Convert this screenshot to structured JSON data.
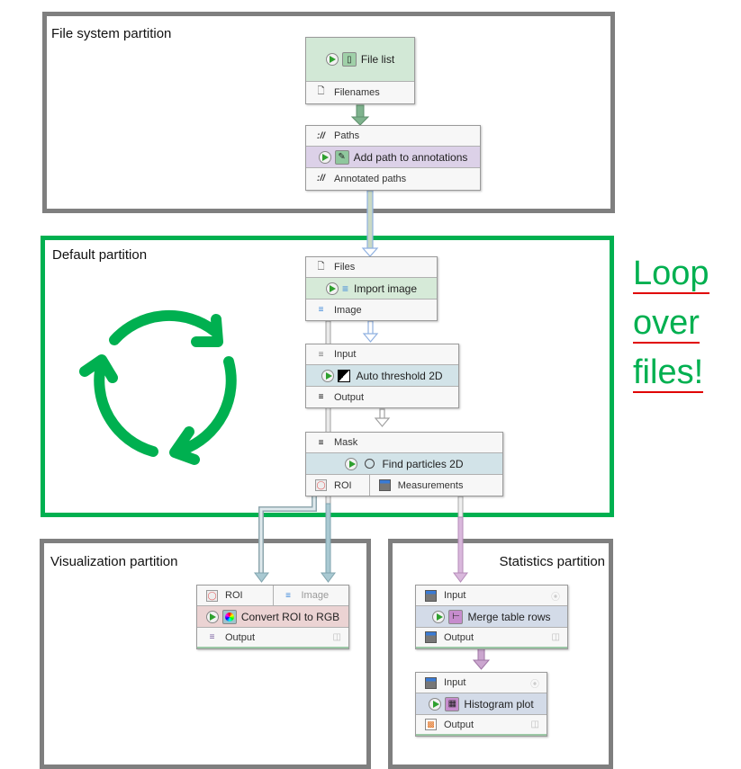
{
  "partitions": {
    "file_system": {
      "title": "File system partition"
    },
    "default": {
      "title": "Default partition"
    },
    "visualization": {
      "title": "Visualization partition"
    },
    "statistics": {
      "title": "Statistics partition"
    }
  },
  "annotation": {
    "lines": [
      "Loop",
      "over",
      "files!"
    ],
    "color": "#00b050",
    "underline_color": "#e00000"
  },
  "nodes": {
    "file_list": {
      "name": "File list",
      "color": "#d2e8d6",
      "outputs": [
        "Filenames"
      ]
    },
    "add_path": {
      "name": "Add path to annotations",
      "color": "#dcd1e8",
      "inputs": [
        "Paths"
      ],
      "outputs": [
        "Annotated paths"
      ]
    },
    "import_image": {
      "name": "Import image",
      "color": "#d6ead8",
      "inputs": [
        "Files"
      ],
      "outputs": [
        "Image"
      ]
    },
    "auto_threshold": {
      "name": "Auto threshold 2D",
      "color": "#d2e3e8",
      "inputs": [
        "Input"
      ],
      "outputs": [
        "Output"
      ]
    },
    "find_particles": {
      "name": "Find particles 2D",
      "color": "#d2e3e8",
      "inputs": [
        "Mask"
      ],
      "outputs": [
        "ROI",
        "Measurements"
      ]
    },
    "convert_roi": {
      "name": "Convert ROI to RGB",
      "color": "#ebd3d3",
      "inputs": [
        "ROI",
        "Image"
      ],
      "outputs": [
        "Output"
      ]
    },
    "merge_rows": {
      "name": "Merge table rows",
      "color": "#d3dbe8",
      "inputs": [
        "Input"
      ],
      "outputs": [
        "Output"
      ]
    },
    "histogram": {
      "name": "Histogram plot",
      "color": "#d3dbe8",
      "inputs": [
        "Input"
      ],
      "outputs": [
        "Output"
      ]
    }
  },
  "colors": {
    "partition_border": "#7f7f7f",
    "default_partition_border": "#00b050",
    "loop_icon": "#00b050",
    "edge_green": "#6aa27a",
    "edge_blue": "#8fb0e0",
    "edge_gray": "#a0a0a0",
    "edge_teal": "#8cb2bf",
    "edge_purple": "#c79bcc"
  }
}
